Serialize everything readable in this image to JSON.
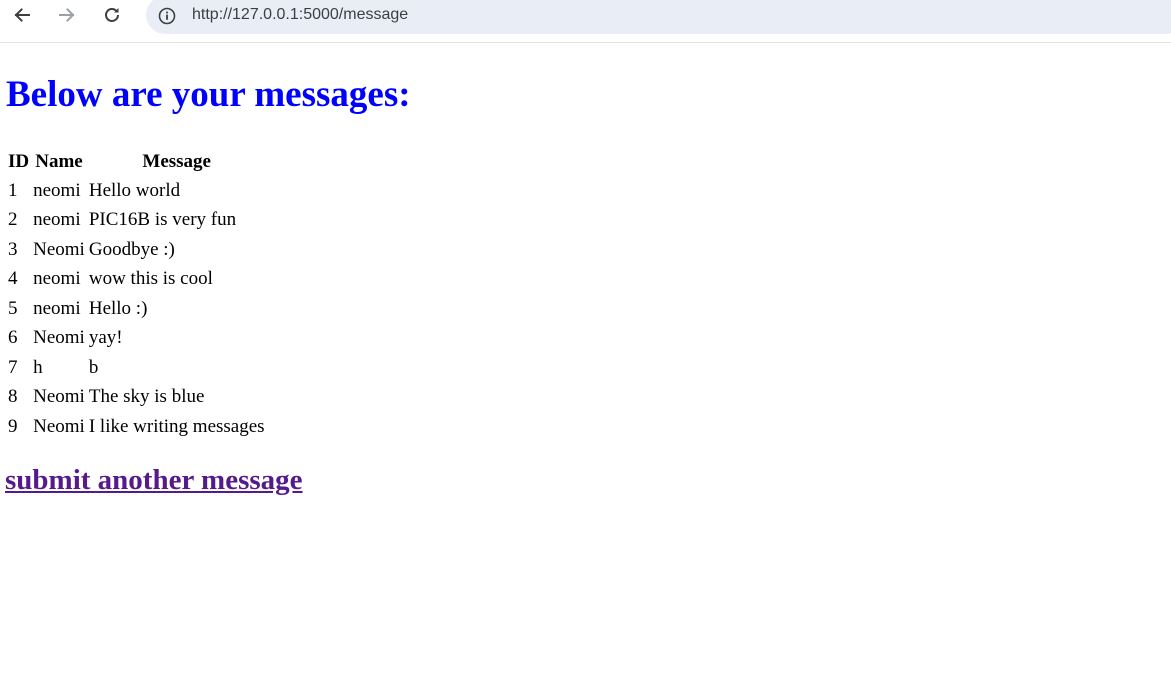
{
  "browser": {
    "url": "http://127.0.0.1:5000/message"
  },
  "page": {
    "heading": "Below are your messages:",
    "table": {
      "headers": [
        "ID",
        "Name",
        "Message"
      ],
      "rows": [
        [
          "1",
          "neomi",
          "Hello world"
        ],
        [
          "2",
          "neomi",
          "PIC16B is very fun"
        ],
        [
          "3",
          "Neomi",
          "Goodbye :)"
        ],
        [
          "4",
          "neomi",
          "wow this is cool"
        ],
        [
          "5",
          "neomi",
          "Hello :)"
        ],
        [
          "6",
          "Neomi",
          "yay!"
        ],
        [
          "7",
          "h",
          "b"
        ],
        [
          "8",
          "Neomi",
          "The sky is blue"
        ],
        [
          "9",
          "Neomi",
          "I like writing messages"
        ]
      ]
    },
    "link_label": "submit another message"
  },
  "icons": {
    "back": "arrow-left-icon",
    "forward": "arrow-right-icon",
    "reload": "reload-icon",
    "site_info": "info-icon"
  },
  "colors": {
    "heading": "#0000ff",
    "visited_link": "#551a8b",
    "omnibox": "#e9edf6"
  }
}
